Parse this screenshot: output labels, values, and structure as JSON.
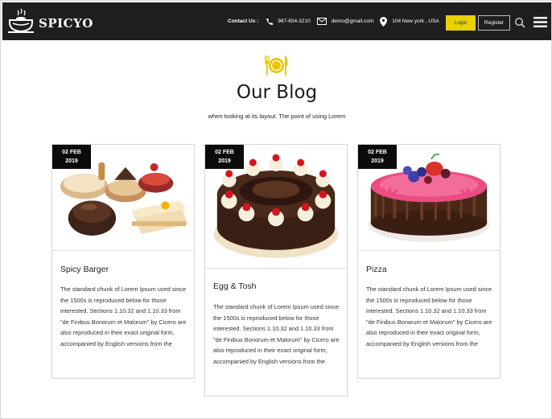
{
  "brand": {
    "name": "SPICYO",
    "logo_icon": "cooking-pot-icon"
  },
  "header": {
    "contact_label": "Contact Us :",
    "phone": "987-654-3210",
    "email": "demo@gmail.com",
    "address": "104 New york , USA",
    "login_label": "Login",
    "register_label": "Register",
    "search_icon": "search-icon",
    "menu_icon": "hamburger-menu-icon"
  },
  "section": {
    "icon": "plate-fork-knife-icon",
    "title": "Our Blog",
    "subtitle": "when looking at its layout. The point of using Lorem"
  },
  "posts": [
    {
      "date_day": "02 FEB",
      "date_year": "2019",
      "image": "pastry-assortment-image",
      "title": "Spicy Barger",
      "text": "The standard chunk of Lorem Ipsum used since the 1500s is reproduced below for those interested. Sections 1.10.32 and 1.10.33 from \"de Finibus Bonorum et Malorum\" by Cicero are also reproduced in their exact original form, accompanied by English versions from the"
    },
    {
      "date_day": "02 FEB",
      "date_year": "2019",
      "image": "chocolate-cake-image",
      "title": "Egg & Tosh",
      "text": "The standard chunk of Lorem Ipsum used since the 1500s is reproduced below for those interested. Sections 1.10.32 and 1.10.33 from \"de Finibus Bonorum et Malorum\" by Cicero are also reproduced in their exact original form, accompanied by English versions from the"
    },
    {
      "date_day": "02 FEB",
      "date_year": "2019",
      "image": "berry-cake-image",
      "title": "Pizza",
      "text": "The standard chunk of Lorem Ipsum used since the 1500s is reproduced below for those interested. Sections 1.10.32 and 1.10.33 from \"de Finibus Bonorum et Malorum\" by Cicero are also reproduced in their exact original form, accompanied by English versions from the"
    }
  ],
  "colors": {
    "header_bg": "#1f1f1f",
    "accent": "#e8c600",
    "date_bg": "#0b0b0b"
  }
}
